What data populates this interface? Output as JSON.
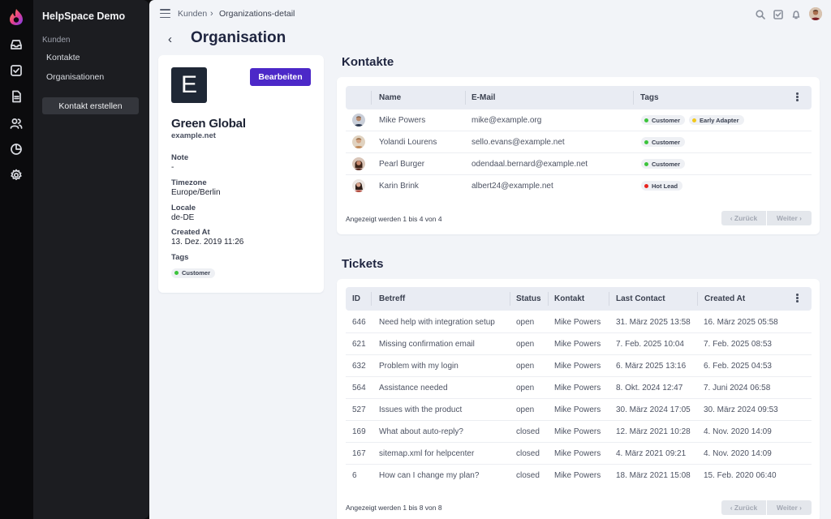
{
  "app": {
    "brand": "HelpSpace Demo"
  },
  "sidebar": {
    "group": "Kunden",
    "items": [
      {
        "label": "Kontakte"
      },
      {
        "label": "Organisationen"
      }
    ],
    "button": "Kontakt erstellen"
  },
  "breadcrumb": {
    "parent": "Kunden",
    "separator": "›",
    "current": "Organizations-detail"
  },
  "page": {
    "back": "‹",
    "title": "Organisation"
  },
  "org": {
    "logo_letter": "E",
    "edit_label": "Bearbeiten",
    "name": "Green Global",
    "domain": "example.net",
    "fields": [
      {
        "label": "Note",
        "value": "-"
      },
      {
        "label": "Timezone",
        "value": "Europe/Berlin"
      },
      {
        "label": "Locale",
        "value": "de-DE"
      },
      {
        "label": "Created At",
        "value": "13. Dez. 2019 11:26"
      }
    ],
    "tags_label": "Tags",
    "tags": [
      {
        "label": "Customer",
        "color": "#3cc43c"
      }
    ]
  },
  "contacts": {
    "title": "Kontakte",
    "columns": [
      "Name",
      "E-Mail",
      "Tags"
    ],
    "rows": [
      {
        "name": "Mike Powers",
        "email": "mike@example.org",
        "tags": [
          {
            "label": "Customer",
            "color": "#3cc43c"
          },
          {
            "label": "Early Adapter",
            "color": "#f2c81c"
          }
        ]
      },
      {
        "name": "Yolandi Lourens",
        "email": "sello.evans@example.net",
        "tags": [
          {
            "label": "Customer",
            "color": "#3cc43c"
          }
        ]
      },
      {
        "name": "Pearl Burger",
        "email": "odendaal.bernard@example.net",
        "tags": [
          {
            "label": "Customer",
            "color": "#3cc43c"
          }
        ]
      },
      {
        "name": "Karin Brink",
        "email": "albert24@example.net",
        "tags": [
          {
            "label": "Hot Lead",
            "color": "#e8231e"
          }
        ]
      }
    ],
    "pager_info": "Angezeigt werden 1 bis 4 von 4",
    "prev": "‹ Zurück",
    "next": "Weiter ›"
  },
  "tickets": {
    "title": "Tickets",
    "columns": [
      "ID",
      "Betreff",
      "Status",
      "Kontakt",
      "Last Contact",
      "Created At"
    ],
    "rows": [
      {
        "id": "646",
        "subject": "Need help with integration setup",
        "status": "open",
        "contact": "Mike Powers",
        "last": "31. März 2025 13:58",
        "created": "16. März 2025 05:58"
      },
      {
        "id": "621",
        "subject": "Missing confirmation email",
        "status": "open",
        "contact": "Mike Powers",
        "last": "7. Feb. 2025 10:04",
        "created": "7. Feb. 2025 08:53"
      },
      {
        "id": "632",
        "subject": "Problem with my login",
        "status": "open",
        "contact": "Mike Powers",
        "last": "6. März 2025 13:16",
        "created": "6. Feb. 2025 04:53"
      },
      {
        "id": "564",
        "subject": "Assistance needed",
        "status": "open",
        "contact": "Mike Powers",
        "last": "8. Okt. 2024 12:47",
        "created": "7. Juni 2024 06:58"
      },
      {
        "id": "527",
        "subject": "Issues with the product",
        "status": "open",
        "contact": "Mike Powers",
        "last": "30. März 2024 17:05",
        "created": "30. März 2024 09:53"
      },
      {
        "id": "169",
        "subject": "What about auto-reply?",
        "status": "closed",
        "contact": "Mike Powers",
        "last": "12. März 2021 10:28",
        "created": "4. Nov. 2020 14:09"
      },
      {
        "id": "167",
        "subject": "sitemap.xml for helpcenter",
        "status": "closed",
        "contact": "Mike Powers",
        "last": "4. März 2021 09:21",
        "created": "4. Nov. 2020 14:09"
      },
      {
        "id": "6",
        "subject": "How can I change my plan?",
        "status": "closed",
        "contact": "Mike Powers",
        "last": "18. März 2021 15:08",
        "created": "15. Feb. 2020 06:40"
      }
    ],
    "pager_info": "Angezeigt werden 1 bis 8 von 8",
    "prev": "‹ Zurück",
    "next": "Weiter ›"
  },
  "icons": {
    "rail": [
      "inbox-icon",
      "tasks-icon",
      "document-icon",
      "users-icon",
      "reports-icon",
      "settings-icon"
    ],
    "topbar": [
      "search-icon",
      "check-square-icon",
      "bell-icon"
    ]
  }
}
